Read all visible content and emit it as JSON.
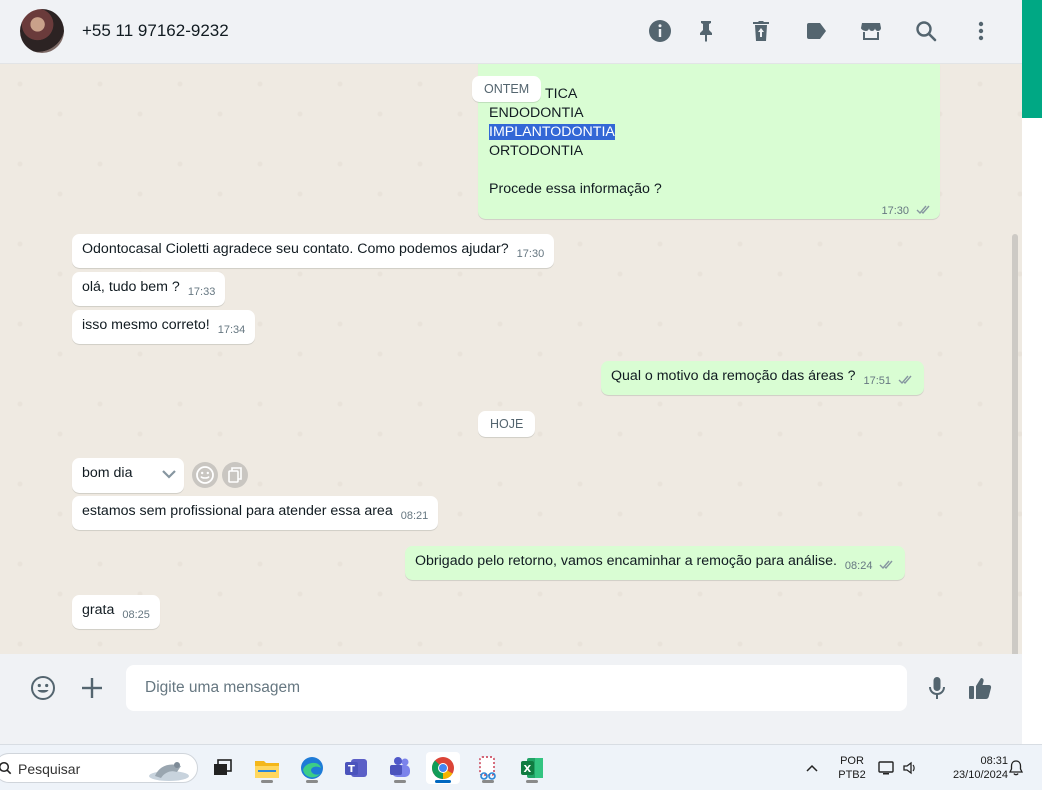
{
  "header": {
    "contact": "+55 11 97162-9232",
    "icons": [
      "info-icon",
      "pin-icon",
      "delete-icon",
      "label-icon",
      "store-icon",
      "search-icon",
      "menu-icon"
    ]
  },
  "messages": {
    "top_partial": "TICA",
    "top_line2": "ENDODONTIA",
    "top_line3": "IMPLANTODONTIA",
    "top_line4": "ORTODONTIA",
    "top_line5": "Procede essa informação ?",
    "top_time": "17:30",
    "date_ontem": "ONTEM",
    "m1_text": "Odontocasal Cioletti agradece seu contato. Como podemos ajudar?",
    "m1_time": "17:30",
    "m2_text": "olá, tudo bem ?",
    "m2_time": "17:33",
    "m3_text": "isso mesmo correto!",
    "m3_time": "17:34",
    "m4_text": "Qual o motivo da remoção das áreas ?",
    "m4_time": "17:51",
    "date_hoje": "HOJE",
    "m5_text": "bom dia",
    "m6_text": "estamos sem profissional para atender essa area",
    "m6_time": "08:21",
    "m7_text": "Obrigado pelo retorno, vamos encaminhar a remoção para análise.",
    "m7_time": "08:24",
    "m8_text": "grata",
    "m8_time": "08:25"
  },
  "footer": {
    "placeholder": "Digite uma mensagem"
  },
  "taskbar": {
    "search_placeholder": "Pesquisar",
    "lang_line1": "POR",
    "lang_line2": "PTB2",
    "clock_time": "08:31",
    "clock_date": "23/10/2024"
  },
  "colors": {
    "outgoing": "#d9fdd3",
    "incoming": "#ffffff",
    "accent": "#00a884",
    "highlight": "#3367d6"
  }
}
